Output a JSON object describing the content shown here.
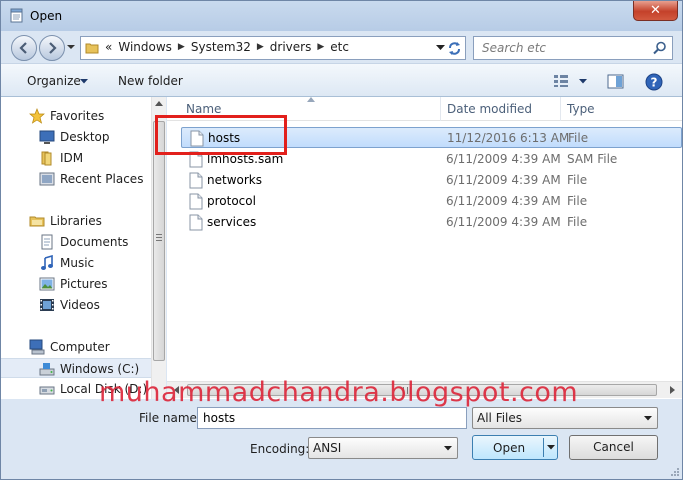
{
  "window": {
    "title": "Open",
    "close_glyph": "✕"
  },
  "navigation": {
    "address": {
      "overflow": "«",
      "crumbs": [
        "Windows",
        "System32",
        "drivers",
        "etc"
      ],
      "separator": "▶"
    },
    "search_placeholder": "Search etc"
  },
  "toolbar": {
    "organize_label": "Organize",
    "new_folder_label": "New folder"
  },
  "sidebar": {
    "items": [
      {
        "label": "Favorites",
        "icon": "star-icon"
      },
      {
        "label": "Desktop",
        "icon": "desktop-icon"
      },
      {
        "label": "IDM",
        "icon": "folder-icon"
      },
      {
        "label": "Recent Places",
        "icon": "recent-places-icon"
      },
      {
        "label": "Libraries",
        "icon": "libraries-icon"
      },
      {
        "label": "Documents",
        "icon": "documents-icon"
      },
      {
        "label": "Music",
        "icon": "music-icon"
      },
      {
        "label": "Pictures",
        "icon": "pictures-icon"
      },
      {
        "label": "Videos",
        "icon": "videos-icon"
      },
      {
        "label": "Computer",
        "icon": "computer-icon"
      },
      {
        "label": "Windows (C:)",
        "icon": "drive-icon"
      },
      {
        "label": "Local Disk (D:)",
        "icon": "drive-icon"
      }
    ]
  },
  "file_list": {
    "columns": [
      "Name",
      "Date modified",
      "Type"
    ],
    "rows": [
      {
        "name": "hosts",
        "date": "11/12/2016 6:13 AM",
        "type": "File"
      },
      {
        "name": "lmhosts.sam",
        "date": "6/11/2009 4:39 AM",
        "type": "SAM File"
      },
      {
        "name": "networks",
        "date": "6/11/2009 4:39 AM",
        "type": "File"
      },
      {
        "name": "protocol",
        "date": "6/11/2009 4:39 AM",
        "type": "File"
      },
      {
        "name": "services",
        "date": "6/11/2009 4:39 AM",
        "type": "File"
      }
    ]
  },
  "footer": {
    "file_name_label": "File name:",
    "file_name_value": "hosts",
    "file_type_value": "All Files",
    "encoding_label": "Encoding:",
    "encoding_value": "ANSI",
    "open_label": "Open",
    "cancel_label": "Cancel"
  },
  "watermark": "muhammadchandra.blogspot.com",
  "colors": {
    "accent_frame": "#dbe6f3",
    "selection": "#c1dcfc",
    "highlight_box": "#e2201c",
    "watermark": "#dc283c"
  }
}
